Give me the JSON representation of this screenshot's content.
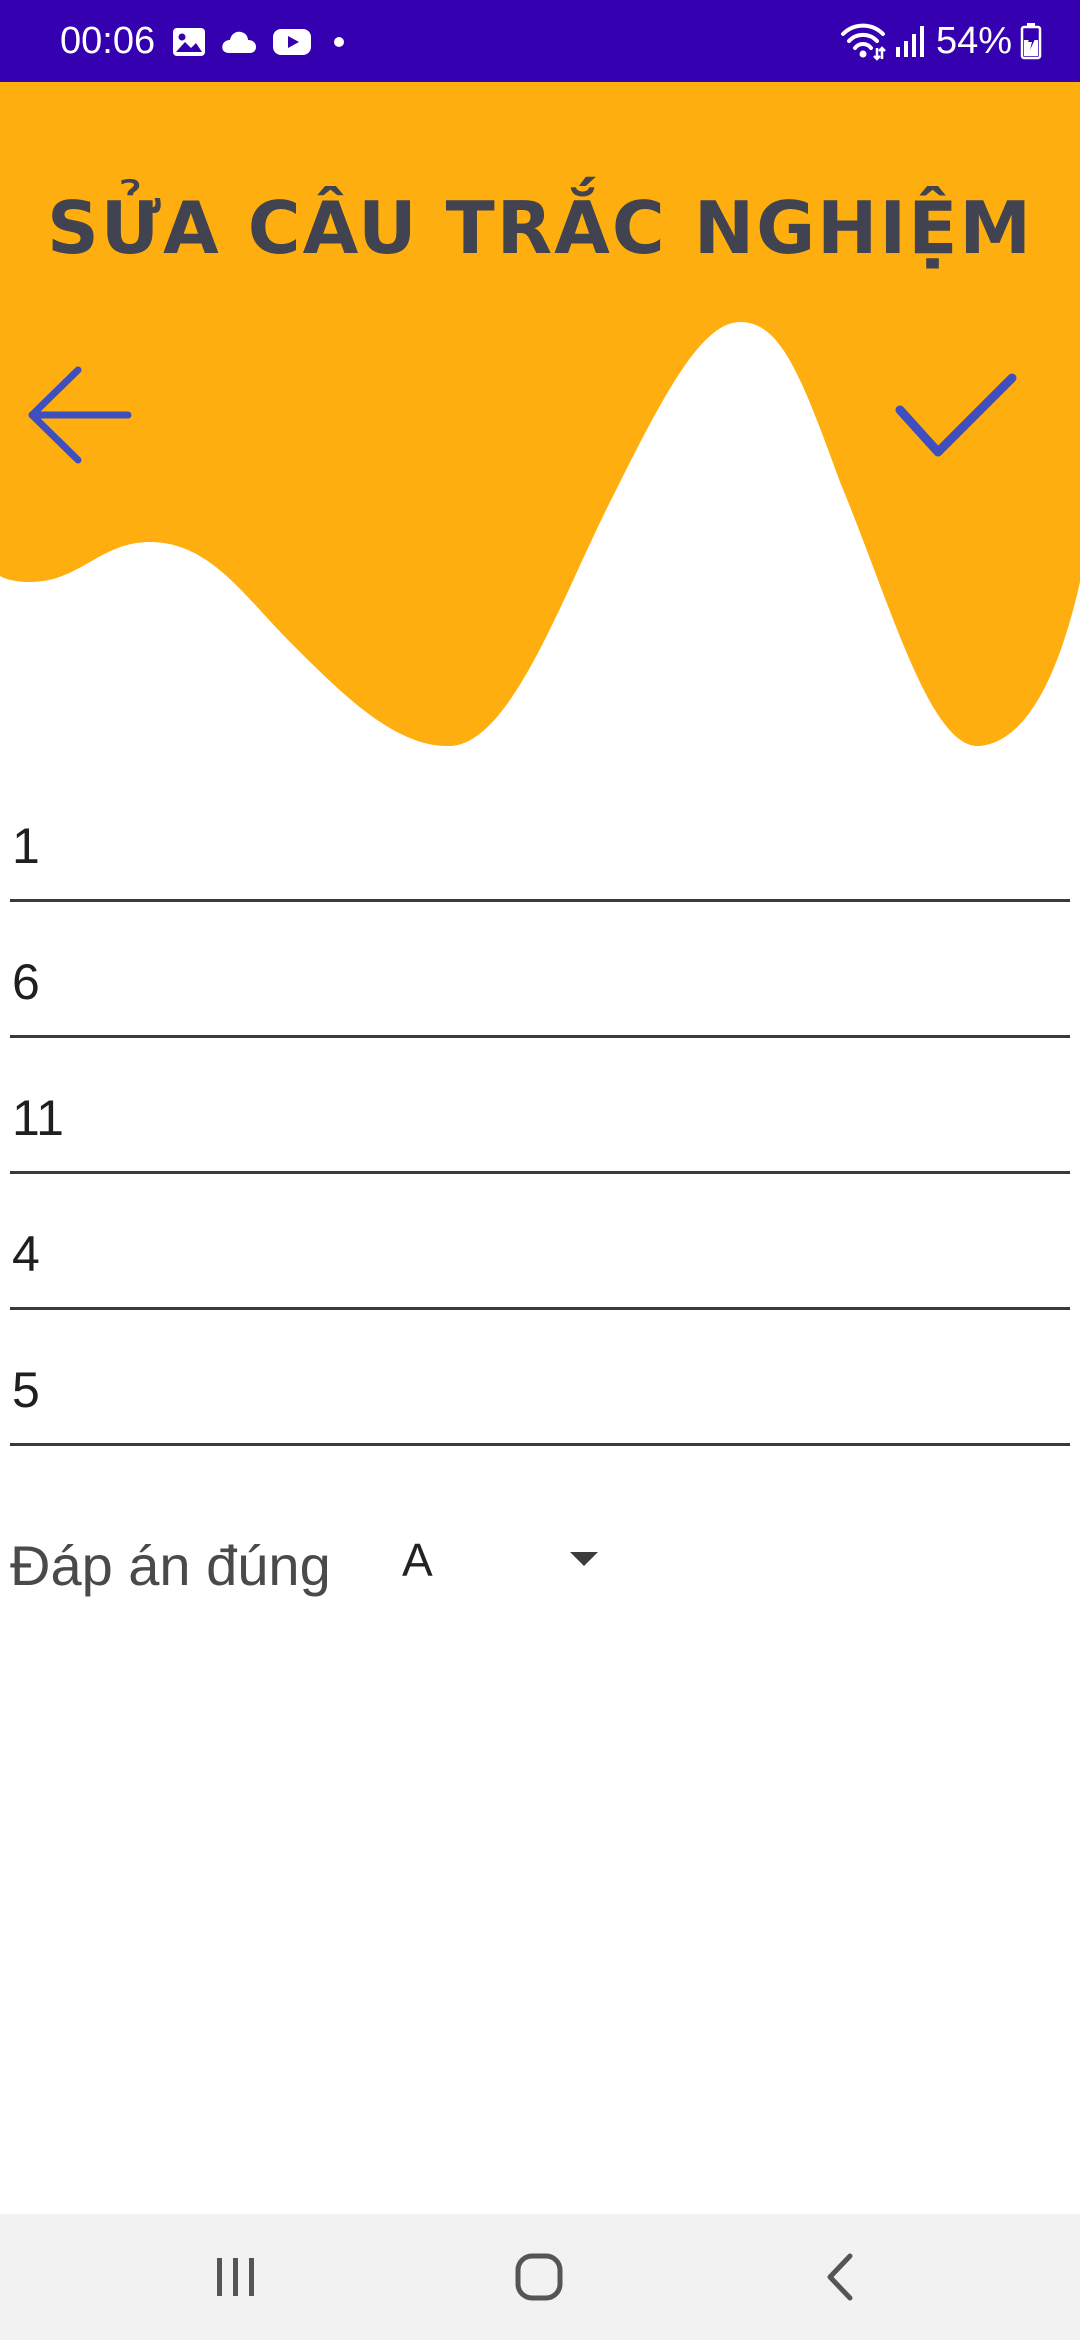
{
  "status_bar": {
    "time": "00:06",
    "battery": "54%",
    "background_color": "#3400b0",
    "icons_left": [
      "image-icon",
      "cloud-icon",
      "youtube-icon",
      "dot-icon"
    ],
    "icons_right": [
      "wifi-icon",
      "signal-icon",
      "battery-icon"
    ]
  },
  "header": {
    "title": "SỬA CÂU TRẮC NGHIỆM",
    "accent_color": "#ffae0f",
    "icon_color": "#3f4fbf",
    "back_icon": "arrow-left-icon",
    "confirm_icon": "check-icon"
  },
  "form": {
    "fields": [
      "1",
      "6",
      "11",
      "4",
      "5"
    ],
    "correct_answer_label": "Đáp án đúng",
    "correct_answer_value": "A"
  },
  "nav_bar": {
    "buttons": [
      "recent-apps-icon",
      "home-icon",
      "back-icon"
    ]
  }
}
